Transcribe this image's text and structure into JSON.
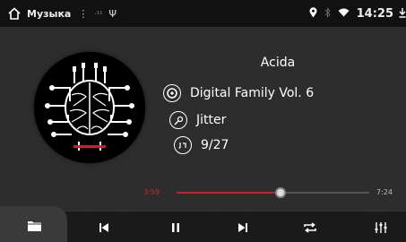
{
  "status_bar": {
    "app_title": "Музыка",
    "menu_glyph": "⋮",
    "indicator_text": "·¹¹",
    "usb_glyph": "Ψ",
    "location_glyph": "●",
    "time": "14:25"
  },
  "track": {
    "title": "Acida",
    "album": "Digital Family Vol. 6",
    "artist": "Jitter",
    "track_number": "9/27"
  },
  "playback": {
    "elapsed": "3:59",
    "total": "7:24",
    "progress_fraction": 0.54
  },
  "colors": {
    "accent": "#c9202a",
    "background": "#2b2b2b",
    "status_bar": "#111111"
  },
  "icons": {
    "home": "home-icon",
    "folder": "folder-icon",
    "previous": "skip-previous-icon",
    "pause": "pause-icon",
    "next": "skip-next-icon",
    "repeat": "repeat-icon",
    "equalizer": "equalizer-icon"
  }
}
